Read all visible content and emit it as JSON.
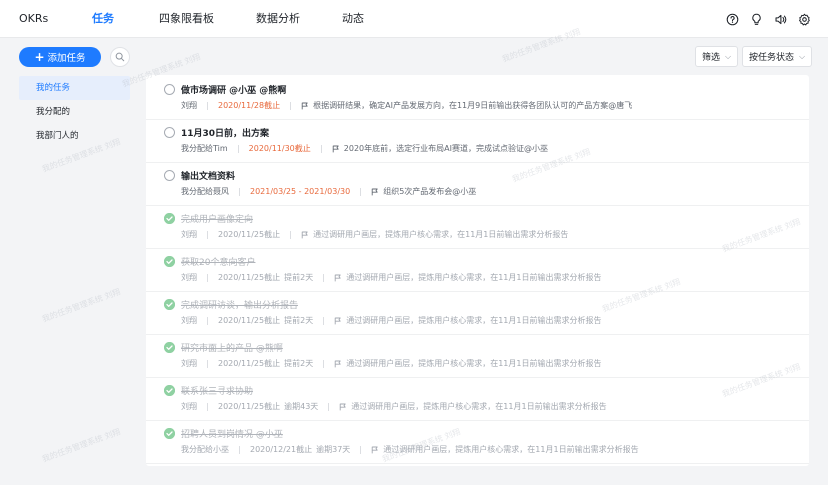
{
  "header": {
    "tabs": [
      {
        "label": "OKRs",
        "active": false
      },
      {
        "label": "任务",
        "active": true
      },
      {
        "label": "四象限看板",
        "active": false
      },
      {
        "label": "数据分析",
        "active": false
      },
      {
        "label": "动态",
        "active": false
      }
    ],
    "icons": [
      "help-icon",
      "bulb-icon",
      "speaker-icon",
      "gear-icon"
    ],
    "accent": "#1e7bff"
  },
  "toolbar": {
    "add_label": "添加任务",
    "filter_label": "筛选",
    "sort_label": "按任务状态"
  },
  "sidebar": {
    "items": [
      {
        "label": "我的任务",
        "active": true
      },
      {
        "label": "我分配的",
        "active": false
      },
      {
        "label": "我部门人的",
        "active": false
      }
    ]
  },
  "tasks": [
    {
      "title": "做市场调研 @小巫 @熊啊",
      "owner": "刘翔",
      "due": "2020/11/28截止",
      "due_red": true,
      "extra": "",
      "note": "根据调研结果，确定AI产品发展方向，在11月9日前输出获得各团队认可的产品方案@唐飞",
      "done": false
    },
    {
      "title": "11月30日前，出方案",
      "owner": "我分配给Tim",
      "due": "2020/11/30截止",
      "due_red": true,
      "extra": "",
      "note": "2020年底前，选定行业布局AI赛道，完成试点验证@小巫",
      "done": false
    },
    {
      "title": "输出文档资料",
      "owner": "我分配给聂风",
      "due": "2021/03/25 - 2021/03/30",
      "due_red": true,
      "extra": "",
      "note": "组织5次产品发布会@小巫",
      "done": false
    },
    {
      "title": "完成用户画像定向",
      "owner": "刘翔",
      "due": "2020/11/25截止",
      "due_red": false,
      "extra": "",
      "note": "通过调研用户画层，提炼用户核心需求，在11月1日前输出需求分析报告",
      "done": true
    },
    {
      "title": "获取20个意向客户",
      "owner": "刘翔",
      "due": "2020/11/25截止",
      "due_red": false,
      "extra": "提前2天",
      "note": "通过调研用户画层，提炼用户核心需求，在11月1日前输出需求分析报告",
      "done": true
    },
    {
      "title": "完成调研访谈，输出分析报告",
      "owner": "刘翔",
      "due": "2020/11/25截止",
      "due_red": false,
      "extra": "提前2天",
      "note": "通过调研用户画层，提炼用户核心需求，在11月1日前输出需求分析报告",
      "done": true
    },
    {
      "title": "研究市面上的产品 @熊啊",
      "owner": "刘翔",
      "due": "2020/11/25截止",
      "due_red": false,
      "extra": "提前2天",
      "note": "通过调研用户画层，提炼用户核心需求，在11月1日前输出需求分析报告",
      "done": true
    },
    {
      "title": "联系张三寻求协助",
      "owner": "刘翔",
      "due": "2020/11/25截止",
      "due_red": false,
      "extra": "逾期43天",
      "note": "通过调研用户画层，提炼用户核心需求，在11月1日前输出需求分析报告",
      "done": true
    },
    {
      "title": "招聘人员到岗情况 @小巫",
      "owner": "我分配给小巫",
      "due": "2020/12/21截止",
      "due_red": false,
      "extra": "逾期37天",
      "note": "通过调研用户画层，提炼用户核心需求，在11月1日前输出需求分析报告",
      "done": true
    }
  ],
  "watermark": "我的任务管理系统 刘翔"
}
